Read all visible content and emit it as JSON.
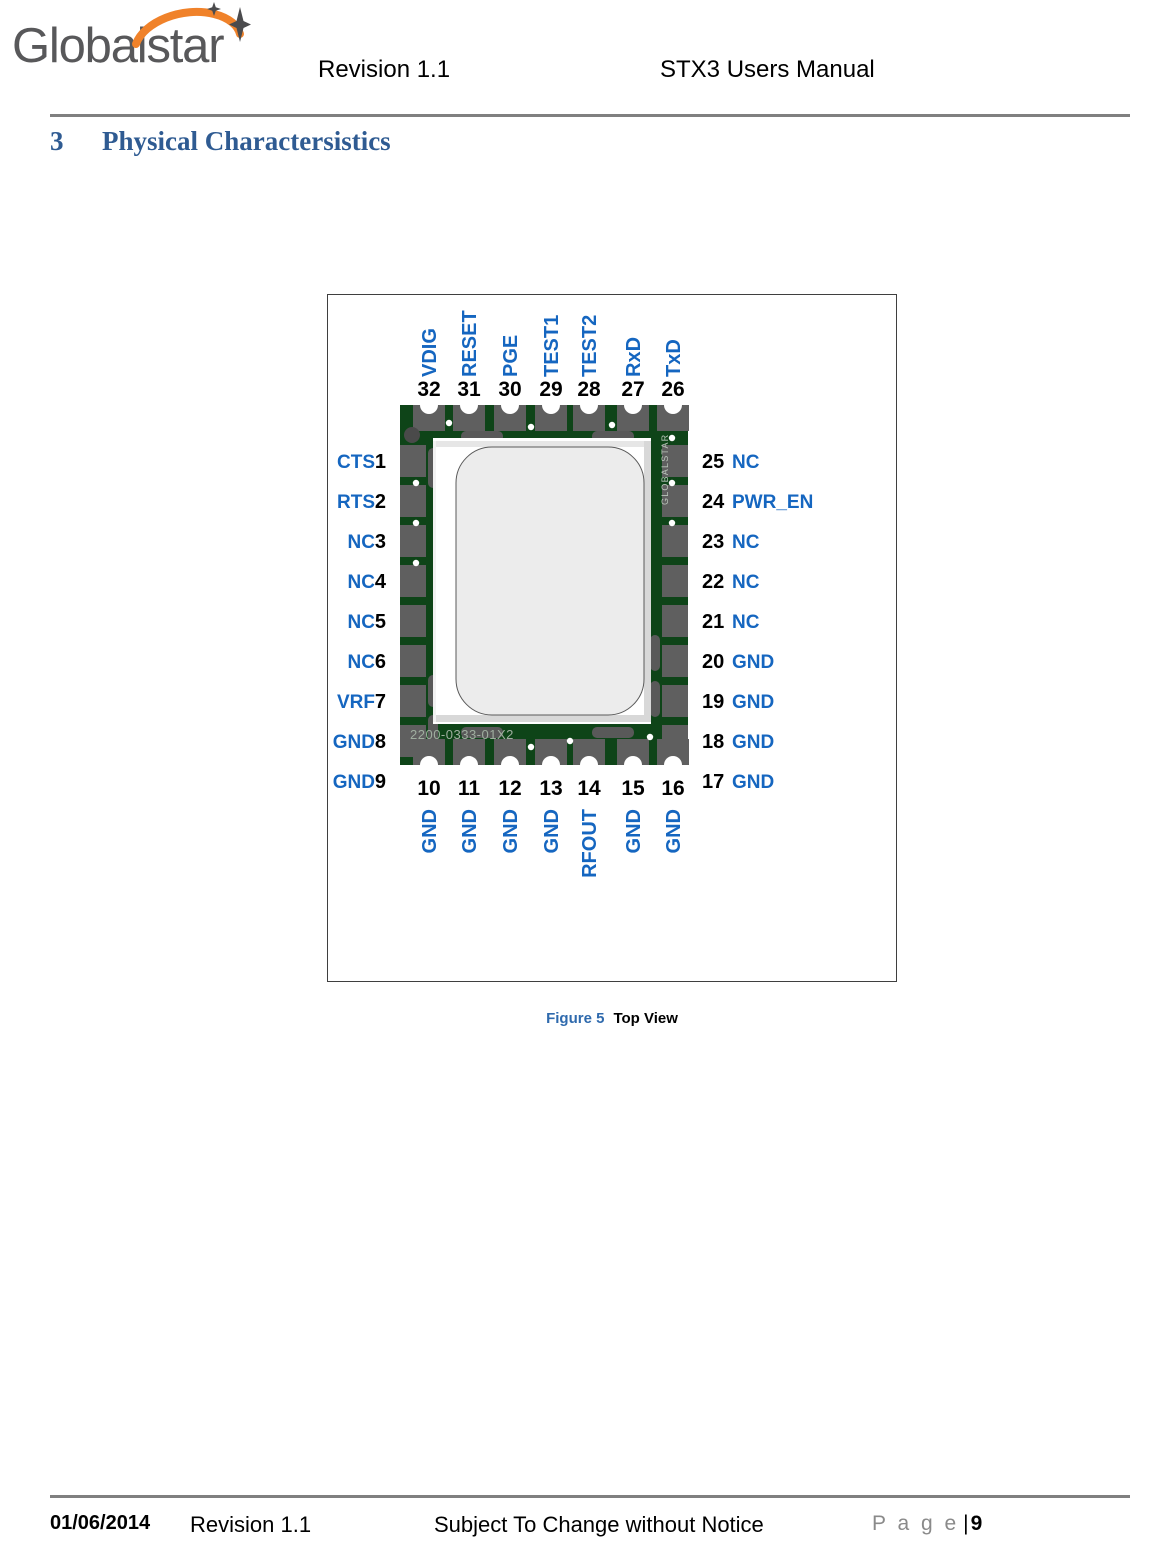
{
  "header": {
    "logo_text": "Globalstar",
    "revision": "Revision 1.1",
    "doc_title": "STX3 Users Manual"
  },
  "section": {
    "number": "3",
    "title": "Physical Charactersistics"
  },
  "figure": {
    "caption_figure": "Figure 5",
    "caption_title": "Top View",
    "board": {
      "part_number": "2200-0333-01X2",
      "brand_silkscreen": "GLOBALSTAR",
      "pcb_color": "#0e4418",
      "pad_color": "#5f5f5f",
      "shield_color": "#ececec",
      "label_color": "#1566c0"
    },
    "pins": {
      "top": [
        {
          "num": "32",
          "label": "VDIG"
        },
        {
          "num": "31",
          "label": "RESET"
        },
        {
          "num": "30",
          "label": "PGE"
        },
        {
          "num": "29",
          "label": "TEST1"
        },
        {
          "num": "28",
          "label": "TEST2"
        },
        {
          "num": "27",
          "label": "RxD"
        },
        {
          "num": "26",
          "label": "TxD"
        }
      ],
      "left": [
        {
          "num": "1",
          "label": "CTS"
        },
        {
          "num": "2",
          "label": "RTS"
        },
        {
          "num": "3",
          "label": "NC"
        },
        {
          "num": "4",
          "label": "NC"
        },
        {
          "num": "5",
          "label": "NC"
        },
        {
          "num": "6",
          "label": "NC"
        },
        {
          "num": "7",
          "label": "VRF"
        },
        {
          "num": "8",
          "label": "GND"
        },
        {
          "num": "9",
          "label": "GND"
        }
      ],
      "bottom": [
        {
          "num": "10",
          "label": "GND"
        },
        {
          "num": "11",
          "label": "GND"
        },
        {
          "num": "12",
          "label": "GND"
        },
        {
          "num": "13",
          "label": "GND"
        },
        {
          "num": "14",
          "label": "RFOUT"
        },
        {
          "num": "15",
          "label": "GND"
        },
        {
          "num": "16",
          "label": "GND"
        }
      ],
      "right": [
        {
          "num": "25",
          "label": "NC"
        },
        {
          "num": "24",
          "label": "PWR_EN"
        },
        {
          "num": "23",
          "label": "NC"
        },
        {
          "num": "22",
          "label": "NC"
        },
        {
          "num": "21",
          "label": "NC"
        },
        {
          "num": "20",
          "label": "GND"
        },
        {
          "num": "19",
          "label": "GND"
        },
        {
          "num": "18",
          "label": "GND"
        },
        {
          "num": "17",
          "label": "GND"
        }
      ]
    }
  },
  "footer": {
    "date": "01/06/2014",
    "revision": "Revision 1.1",
    "notice": "Subject To Change without Notice",
    "page_word": "P a g e",
    "page_sep": "|",
    "page_number": "9"
  }
}
